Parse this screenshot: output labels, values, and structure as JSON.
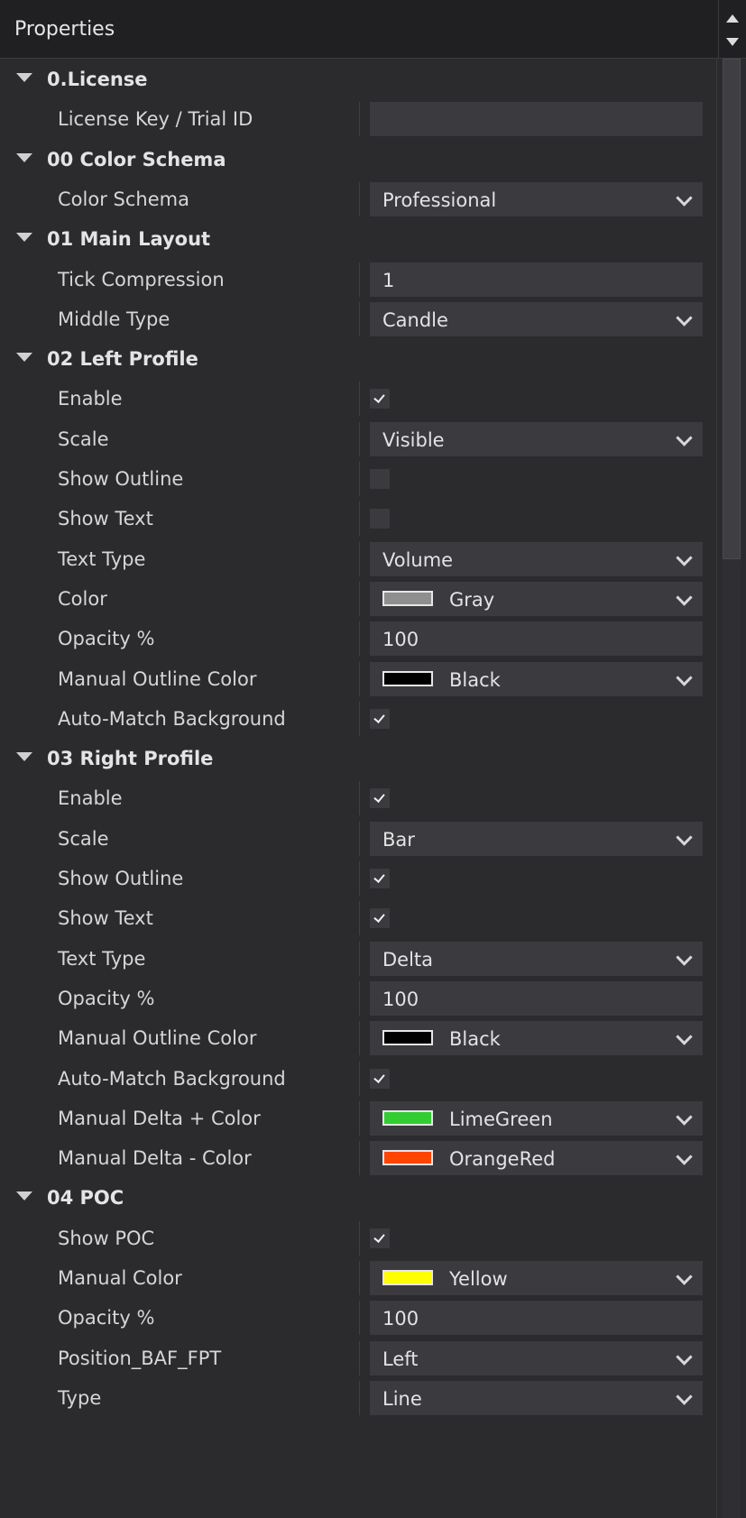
{
  "header": {
    "title": "Properties"
  },
  "icons": {
    "scroll_up": "triangle-up-icon",
    "scroll_down": "triangle-down-icon",
    "expander": "triangle-down-icon",
    "dropdown": "chevron-down-icon",
    "check": "checkmark-icon"
  },
  "colors": {
    "Gray": "#8f8f8f",
    "Black": "#000000",
    "LimeGreen": "#32cd32",
    "OrangeRed": "#ff4500",
    "Yellow": "#ffff00"
  },
  "sections": [
    {
      "title": "0.License",
      "rows": [
        {
          "label": "License Key / Trial ID",
          "type": "text",
          "value": ""
        }
      ]
    },
    {
      "title": "00 Color Schema",
      "rows": [
        {
          "label": "Color Schema",
          "type": "dropdown",
          "value": "Professional"
        }
      ]
    },
    {
      "title": "01 Main Layout",
      "rows": [
        {
          "label": "Tick Compression",
          "type": "text",
          "value": "1"
        },
        {
          "label": "Middle Type",
          "type": "dropdown",
          "value": "Candle"
        }
      ]
    },
    {
      "title": "02 Left Profile",
      "rows": [
        {
          "label": "Enable",
          "type": "checkbox",
          "checked": true
        },
        {
          "label": "Scale",
          "type": "dropdown",
          "value": "Visible"
        },
        {
          "label": "Show Outline",
          "type": "checkbox",
          "checked": false
        },
        {
          "label": "Show Text",
          "type": "checkbox",
          "checked": false
        },
        {
          "label": "Text Type",
          "type": "dropdown",
          "value": "Volume"
        },
        {
          "label": "Color",
          "type": "color",
          "value": "Gray"
        },
        {
          "label": "Opacity %",
          "type": "text",
          "value": "100"
        },
        {
          "label": "Manual Outline Color",
          "type": "color",
          "value": "Black"
        },
        {
          "label": "Auto-Match Background",
          "type": "checkbox",
          "checked": true
        }
      ]
    },
    {
      "title": "03 Right Profile",
      "rows": [
        {
          "label": "Enable",
          "type": "checkbox",
          "checked": true
        },
        {
          "label": "Scale",
          "type": "dropdown",
          "value": "Bar"
        },
        {
          "label": "Show Outline",
          "type": "checkbox",
          "checked": true
        },
        {
          "label": "Show Text",
          "type": "checkbox",
          "checked": true
        },
        {
          "label": "Text Type",
          "type": "dropdown",
          "value": "Delta"
        },
        {
          "label": "Opacity %",
          "type": "text",
          "value": "100"
        },
        {
          "label": "Manual Outline Color",
          "type": "color",
          "value": "Black"
        },
        {
          "label": "Auto-Match Background",
          "type": "checkbox",
          "checked": true
        },
        {
          "label": "Manual Delta + Color",
          "type": "color",
          "value": "LimeGreen"
        },
        {
          "label": "Manual Delta - Color",
          "type": "color",
          "value": "OrangeRed"
        }
      ]
    },
    {
      "title": "04 POC",
      "rows": [
        {
          "label": "Show POC",
          "type": "checkbox",
          "checked": true
        },
        {
          "label": "Manual Color",
          "type": "color",
          "value": "Yellow"
        },
        {
          "label": "Opacity %",
          "type": "text",
          "value": "100"
        },
        {
          "label": "Position_BAF_FPT",
          "type": "dropdown",
          "value": "Left"
        },
        {
          "label": "Type",
          "type": "dropdown",
          "value": "Line"
        }
      ]
    }
  ]
}
